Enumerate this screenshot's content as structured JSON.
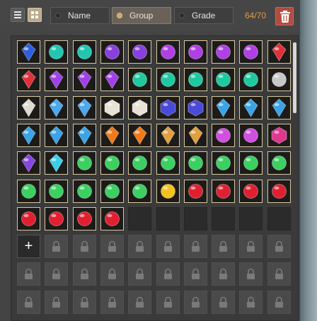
{
  "toolbar": {
    "view_list_icon": "list-icon",
    "view_grid_icon": "grid-icon",
    "sort_options": [
      {
        "label": "Name",
        "selected": false
      },
      {
        "label": "Group",
        "selected": true
      },
      {
        "label": "Grade",
        "selected": false
      }
    ],
    "counter": "64/70",
    "trash_icon": "trash-icon"
  },
  "colors": {
    "accent_orange": "#e39a43",
    "trash_red": "#b34b3f",
    "slot_border": "#d6c9a0",
    "grid_active": "#b9a98e"
  },
  "inventory": {
    "columns": 10,
    "rows": [
      [
        "blue-crystal",
        "teal-gem",
        "teal-gem",
        "purple-gem",
        "purple-gem",
        "purple-orb",
        "purple-orb",
        "purple-orb",
        "purple-orb",
        "red-crystal"
      ],
      [
        "red-crystal",
        "purple-crystal",
        "purple-crystal",
        "purple-crystal",
        "teal-stone",
        "teal-stone",
        "teal-stone",
        "teal-stone",
        "teal-stone",
        "silver-stone"
      ],
      [
        "silver-shard",
        "blue-diamond",
        "blue-diamond",
        "white-cube",
        "white-cube",
        "indigo-box",
        "indigo-box",
        "blue-shard",
        "blue-shard",
        "blue-shard"
      ],
      [
        "blue-shard",
        "blue-shard",
        "blue-shard",
        "orange-shard",
        "orange-shard",
        "amber-shard",
        "amber-shard",
        "magenta-orb",
        "magenta-orb",
        "magenta-hex"
      ],
      [
        "violet-crystal",
        "aqua-crystal",
        "green-gem",
        "green-gem",
        "green-gem",
        "green-gem",
        "green-gem",
        "green-gem",
        "green-gem",
        "green-gem"
      ],
      [
        "green-gem",
        "green-gem",
        "green-gem",
        "green-gem",
        "green-gem",
        "gold-orb",
        "ruby",
        "ruby",
        "ruby",
        "ruby"
      ],
      [
        "ruby",
        "ruby",
        "ruby",
        "ruby",
        "empty",
        "empty",
        "empty",
        "empty",
        "empty",
        "empty"
      ],
      [
        "add",
        "locked",
        "locked",
        "locked",
        "locked",
        "locked",
        "locked",
        "locked",
        "locked",
        "locked"
      ],
      [
        "locked",
        "locked",
        "locked",
        "locked",
        "locked",
        "locked",
        "locked",
        "locked",
        "locked",
        "locked"
      ],
      [
        "locked",
        "locked",
        "locked",
        "locked",
        "locked",
        "locked",
        "locked",
        "locked",
        "locked",
        "locked"
      ]
    ],
    "add_label": "+",
    "lock_icon": "lock-icon"
  },
  "gem_colors": {
    "blue-crystal": "#2d5ee0",
    "teal-gem": "#22c6b0",
    "purple-gem": "#8a3fe0",
    "purple-orb": "#b040e6",
    "red-crystal": "#e0303a",
    "purple-crystal": "#a040e8",
    "teal-stone": "#1fc9a0",
    "silver-stone": "#c8c8c8",
    "silver-shard": "#dedacf",
    "blue-diamond": "#49a8f0",
    "white-cube": "#e8e2d6",
    "indigo-box": "#4a4ad8",
    "blue-shard": "#3aa4e8",
    "orange-shard": "#f07a18",
    "amber-shard": "#e0a040",
    "magenta-orb": "#d050e0",
    "magenta-hex": "#e03890",
    "violet-crystal": "#8844e0",
    "aqua-crystal": "#3ad0e8",
    "green-gem": "#3cd060",
    "gold-orb": "#f4c21c",
    "ruby": "#e02030"
  }
}
